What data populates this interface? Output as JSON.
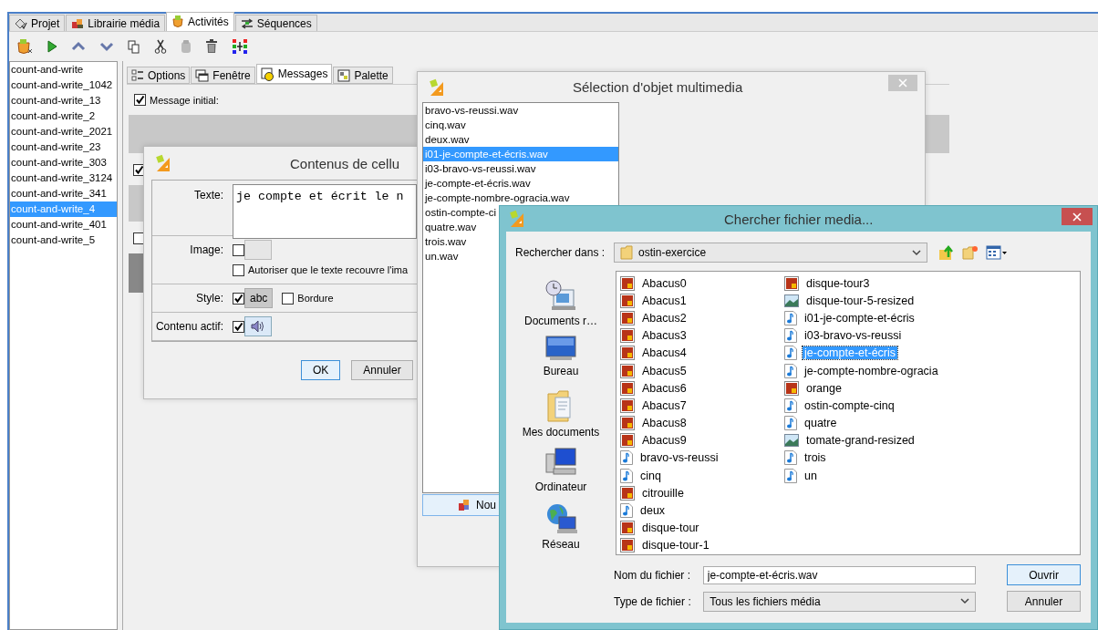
{
  "main_tabs": [
    {
      "label": "Projet",
      "selected": false
    },
    {
      "label": "Librairie média",
      "selected": false
    },
    {
      "label": "Activités",
      "selected": true
    },
    {
      "label": "Séquences",
      "selected": false
    }
  ],
  "activities": [
    {
      "label": "count-and-write",
      "selected": false
    },
    {
      "label": "count-and-write_1042",
      "selected": false
    },
    {
      "label": "count-and-write_13",
      "selected": false
    },
    {
      "label": "count-and-write_2",
      "selected": false
    },
    {
      "label": "count-and-write_2021",
      "selected": false
    },
    {
      "label": "count-and-write_23",
      "selected": false
    },
    {
      "label": "count-and-write_303",
      "selected": false
    },
    {
      "label": "count-and-write_3124",
      "selected": false
    },
    {
      "label": "count-and-write_341",
      "selected": false
    },
    {
      "label": "count-and-write_4",
      "selected": true
    },
    {
      "label": "count-and-write_401",
      "selected": false
    },
    {
      "label": "count-and-write_5",
      "selected": false
    }
  ],
  "panel_tabs": [
    {
      "label": "Options",
      "selected": false
    },
    {
      "label": "Fenêtre",
      "selected": false
    },
    {
      "label": "Messages",
      "selected": true
    },
    {
      "label": "Palette",
      "selected": false
    }
  ],
  "message_initial": {
    "label": "Message initial:",
    "checked": true
  },
  "panel_checks": [
    {
      "checked": true
    },
    {
      "checked": false
    }
  ],
  "cell_dialog": {
    "title": "Contenus de cellu",
    "text_label": "Texte:",
    "text_value": "je compte et écrit le n",
    "image_label": "Image:",
    "image_checked": false,
    "overlap_label": "Autoriser que le texte recouvre l'ima",
    "overlap_checked": false,
    "style_label": "Style:",
    "style_checked": true,
    "style_sample": "abc",
    "border_label": "Bordure",
    "border_checked": false,
    "active_label": "Contenu actif:",
    "active_checked": true,
    "ok_button": "OK",
    "cancel_button": "Annuler"
  },
  "media_dialog": {
    "title": "Sélection d'objet multimedia",
    "items": [
      {
        "label": "bravo-vs-reussi.wav",
        "selected": false
      },
      {
        "label": "cinq.wav",
        "selected": false
      },
      {
        "label": "deux.wav",
        "selected": false
      },
      {
        "label": "i01-je-compte-et-écris.wav",
        "selected": true
      },
      {
        "label": "i03-bravo-vs-reussi.wav",
        "selected": false
      },
      {
        "label": "je-compte-et-écris.wav",
        "selected": false
      },
      {
        "label": "je-compte-nombre-ogracia.wav",
        "selected": false
      },
      {
        "label": "ostin-compte-ci",
        "selected": false
      },
      {
        "label": "quatre.wav",
        "selected": false
      },
      {
        "label": "trois.wav",
        "selected": false
      },
      {
        "label": "un.wav",
        "selected": false
      }
    ],
    "new_button": "Nou"
  },
  "file_dialog": {
    "title": "Chercher fichier media...",
    "look_in_label": "Rechercher dans :",
    "look_in": "ostin-exercice",
    "places": [
      {
        "label": "Documents r…",
        "kind": "recent"
      },
      {
        "label": "Bureau",
        "kind": "desktop"
      },
      {
        "label": "Mes documents",
        "kind": "documents"
      },
      {
        "label": "Ordinateur",
        "kind": "computer"
      },
      {
        "label": "Réseau",
        "kind": "network"
      }
    ],
    "files": [
      {
        "name": "Abacus0",
        "kind": "image",
        "selected": false
      },
      {
        "name": "Abacus1",
        "kind": "image",
        "selected": false
      },
      {
        "name": "Abacus2",
        "kind": "image",
        "selected": false
      },
      {
        "name": "Abacus3",
        "kind": "image",
        "selected": false
      },
      {
        "name": "Abacus4",
        "kind": "image",
        "selected": false
      },
      {
        "name": "Abacus5",
        "kind": "image",
        "selected": false
      },
      {
        "name": "Abacus6",
        "kind": "image",
        "selected": false
      },
      {
        "name": "Abacus7",
        "kind": "image",
        "selected": false
      },
      {
        "name": "Abacus8",
        "kind": "image",
        "selected": false
      },
      {
        "name": "Abacus9",
        "kind": "image",
        "selected": false
      },
      {
        "name": "bravo-vs-reussi",
        "kind": "audio",
        "selected": false
      },
      {
        "name": "cinq",
        "kind": "audio",
        "selected": false
      },
      {
        "name": "citrouille",
        "kind": "image",
        "selected": false
      },
      {
        "name": "deux",
        "kind": "audio",
        "selected": false
      },
      {
        "name": "disque-tour",
        "kind": "image",
        "selected": false
      },
      {
        "name": "disque-tour-1",
        "kind": "image",
        "selected": false
      },
      {
        "name": "disque-tour3",
        "kind": "image",
        "selected": false
      },
      {
        "name": "disque-tour-5-resized",
        "kind": "photo",
        "selected": false
      },
      {
        "name": "i01-je-compte-et-écris",
        "kind": "audio",
        "selected": false
      },
      {
        "name": "i03-bravo-vs-reussi",
        "kind": "audio",
        "selected": false
      },
      {
        "name": "je-compte-et-écris",
        "kind": "audio",
        "selected": true
      },
      {
        "name": "je-compte-nombre-ogracia",
        "kind": "audio",
        "selected": false
      },
      {
        "name": "orange",
        "kind": "image",
        "selected": false
      },
      {
        "name": "ostin-compte-cinq",
        "kind": "audio",
        "selected": false
      },
      {
        "name": "quatre",
        "kind": "audio",
        "selected": false
      },
      {
        "name": "tomate-grand-resized",
        "kind": "photo",
        "selected": false
      },
      {
        "name": "trois",
        "kind": "audio",
        "selected": false
      },
      {
        "name": "un",
        "kind": "audio",
        "selected": false
      }
    ],
    "filename_label": "Nom du fichier :",
    "filename": "je-compte-et-écris.wav",
    "filetype_label": "Type de fichier :",
    "filetype": "Tous les fichiers média",
    "open_button": "Ouvrir",
    "cancel_button": "Annuler"
  }
}
